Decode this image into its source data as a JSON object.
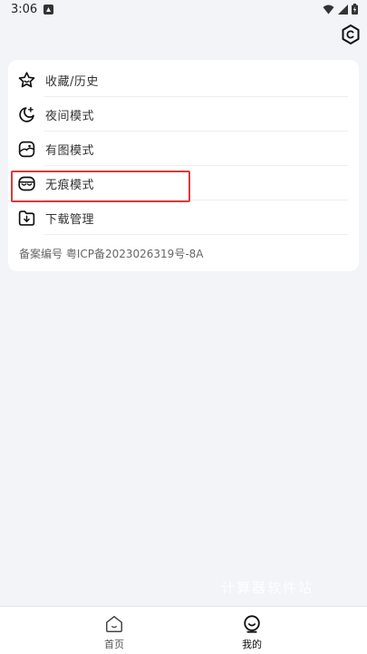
{
  "status_bar": {
    "time": "3:06"
  },
  "menu": [
    {
      "label": "收藏/历史",
      "icon": "star-icon"
    },
    {
      "label": "夜间模式",
      "icon": "moon-icon"
    },
    {
      "label": "有图模式",
      "icon": "image-icon"
    },
    {
      "label": "无痕模式",
      "icon": "incognito-mask-icon"
    },
    {
      "label": "下载管理",
      "icon": "download-icon"
    }
  ],
  "record_number": "备案编号 粤ICP备2023026319号-8A",
  "watermark": "计算器软件站",
  "bottom_nav": {
    "home_label": "首页",
    "mine_label": "我的"
  },
  "colors": {
    "highlight": "#d93a3a",
    "background": "#f3f4f8"
  }
}
